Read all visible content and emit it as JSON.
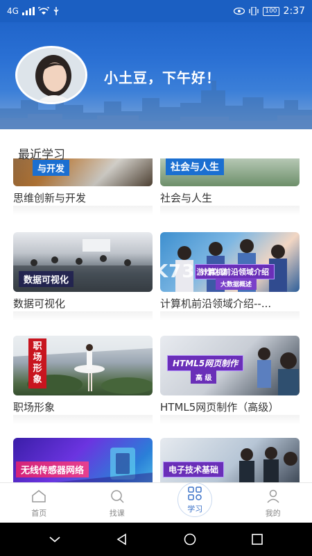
{
  "status": {
    "network": "4G",
    "battery": "100",
    "time": "2:37"
  },
  "header": {
    "greeting": "小土豆，下午好！"
  },
  "section": {
    "title": "最近学习"
  },
  "courses": [
    {
      "name": "思维创新与开发",
      "thumb_text": "与开发"
    },
    {
      "name": "社会与人生",
      "thumb_text": "社会与人生"
    },
    {
      "name": "数据可视化",
      "thumb_text": "数据可视化"
    },
    {
      "name": "计算机前沿领域介绍--...",
      "thumb_text": "计算机前沿领域介绍",
      "thumb_sub": "大数据概述"
    },
    {
      "name": "职场形象",
      "thumb_text": "职场形象"
    },
    {
      "name": "HTML5网页制作（高级）",
      "thumb_text": "HTML5网页制作",
      "thumb_sub": "高 级"
    },
    {
      "name": "",
      "thumb_text": "无线传感器网络"
    },
    {
      "name": "",
      "thumb_text": "电子技术基础"
    }
  ],
  "watermark": {
    "big": "K73",
    "small": "游戏之家"
  },
  "tabs": [
    {
      "label": "首页",
      "icon": "home-icon",
      "active": false
    },
    {
      "label": "找课",
      "icon": "search-icon",
      "active": false
    },
    {
      "label": "学习",
      "icon": "grid-icon",
      "active": true
    },
    {
      "label": "我的",
      "icon": "person-icon",
      "active": false
    }
  ],
  "colors": {
    "primary": "#1b5fc2",
    "active_tab": "#3b72c8",
    "text": "#333333",
    "tab_text": "#888888"
  }
}
